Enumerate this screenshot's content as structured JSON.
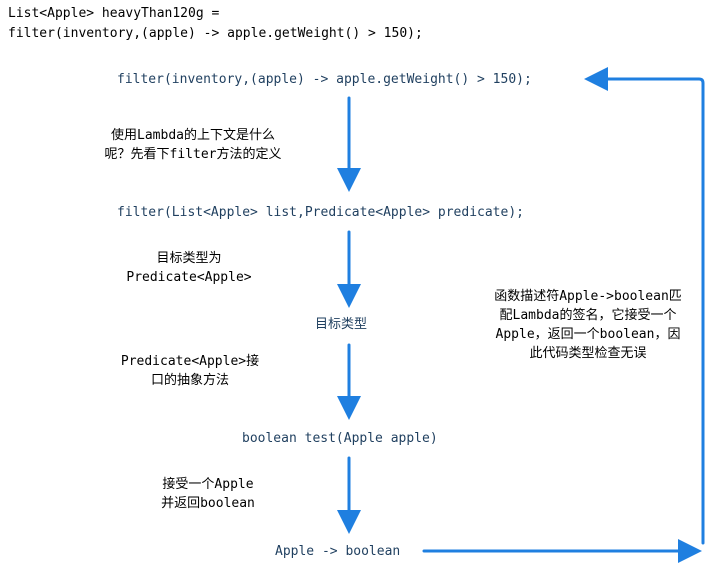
{
  "header": {
    "line1": "List<Apple> heavyThan120g =",
    "line2": "filter(inventory,(apple) -> apple.getWeight() > 150);"
  },
  "steps": [
    {
      "text": "filter(inventory,(apple) -> apple.getWeight() > 150);"
    },
    {
      "text": "filter(List<Apple> list,Predicate<Apple> predicate);"
    },
    {
      "text": "目标类型"
    },
    {
      "text": "boolean test(Apple apple)"
    },
    {
      "text": "Apple -> boolean"
    }
  ],
  "notes": [
    {
      "line1": "使用Lambda的上下文是什么",
      "line2": "呢？先看下filter方法的定义"
    },
    {
      "line1": "目标类型为",
      "line2": "Predicate<Apple>"
    },
    {
      "line1": "Predicate<Apple>接",
      "line2": "口的抽象方法"
    },
    {
      "line1": "接受一个Apple",
      "line2": "并返回boolean"
    }
  ],
  "side_note": {
    "line1": "函数描述符Apple->boolean匹",
    "line2": "配Lambda的签名，它接受一个",
    "line3": "Apple，返回一个boolean，因",
    "line4": "此代码类型检查无误"
  },
  "colors": {
    "arrow": "#1f7fe0",
    "step_text": "#1f3f5f"
  }
}
